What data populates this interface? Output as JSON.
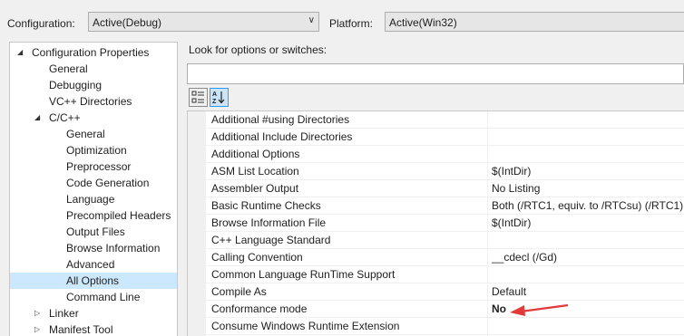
{
  "header": {
    "configuration_label": "Configuration:",
    "configuration_value": "Active(Debug)",
    "platform_label": "Platform:",
    "platform_value": "Active(Win32)"
  },
  "tree": [
    {
      "label": "Configuration Properties",
      "level": 1,
      "expander": "expanded"
    },
    {
      "label": "General",
      "level": 2
    },
    {
      "label": "Debugging",
      "level": 2
    },
    {
      "label": "VC++ Directories",
      "level": 2
    },
    {
      "label": "C/C++",
      "level": 2,
      "expander": "expanded"
    },
    {
      "label": "General",
      "level": 3
    },
    {
      "label": "Optimization",
      "level": 3
    },
    {
      "label": "Preprocessor",
      "level": 3
    },
    {
      "label": "Code Generation",
      "level": 3
    },
    {
      "label": "Language",
      "level": 3
    },
    {
      "label": "Precompiled Headers",
      "level": 3
    },
    {
      "label": "Output Files",
      "level": 3
    },
    {
      "label": "Browse Information",
      "level": 3
    },
    {
      "label": "Advanced",
      "level": 3
    },
    {
      "label": "All Options",
      "level": 3,
      "selected": true
    },
    {
      "label": "Command Line",
      "level": 3
    },
    {
      "label": "Linker",
      "level": 2,
      "expander": "collapsed"
    },
    {
      "label": "Manifest Tool",
      "level": 2,
      "expander": "collapsed"
    }
  ],
  "search": {
    "label": "Look for options or switches:",
    "value": ""
  },
  "toolbar": {
    "categorized_icon": "categorized-view-icon",
    "alphabetical_icon": "alphabetical-sort-icon"
  },
  "properties": [
    {
      "name": "Additional #using Directories",
      "value": ""
    },
    {
      "name": "Additional Include Directories",
      "value": ""
    },
    {
      "name": "Additional Options",
      "value": ""
    },
    {
      "name": "ASM List Location",
      "value": "$(IntDir)"
    },
    {
      "name": "Assembler Output",
      "value": "No Listing"
    },
    {
      "name": "Basic Runtime Checks",
      "value": "Both (/RTC1, equiv. to /RTCsu) (/RTC1)"
    },
    {
      "name": "Browse Information File",
      "value": "$(IntDir)"
    },
    {
      "name": "C++ Language Standard",
      "value": ""
    },
    {
      "name": "Calling Convention",
      "value": "__cdecl (/Gd)"
    },
    {
      "name": "Common Language RunTime Support",
      "value": ""
    },
    {
      "name": "Compile As",
      "value": "Default"
    },
    {
      "name": "Conformance mode",
      "value": "No",
      "bold": true
    },
    {
      "name": "Consume Windows Runtime Extension",
      "value": ""
    }
  ],
  "annotation": {
    "arrow_color": "#e23a3a"
  }
}
